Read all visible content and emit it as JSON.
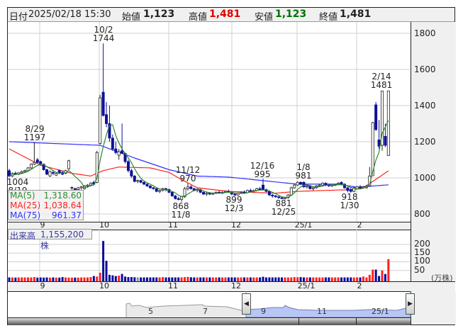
{
  "header": {
    "date_label": "日付",
    "datetime": "2025/02/18 15:30",
    "open_label": "始値",
    "open": "1,123",
    "high_label": "高値",
    "high": "1,481",
    "low_label": "安値",
    "low": "1,123",
    "close_label": "終値",
    "close": "1,481"
  },
  "colors": {
    "up_volume": "#ff2020",
    "down_volume": "#0a0a9a",
    "candle_down": "#10109a",
    "ma5": "#2e8b2e",
    "ma25": "#ff2020",
    "ma75": "#3030ff",
    "high_text": "#e00000",
    "low_text": "#007000"
  },
  "price_axis": {
    "ticks": [
      "1800",
      "1600",
      "1400",
      "1200",
      "1000",
      "800"
    ],
    "values": [
      1800,
      1600,
      1400,
      1200,
      1000,
      800
    ]
  },
  "volume_axis": {
    "ticks": [
      "200",
      "150",
      "100",
      "50"
    ],
    "values": [
      200,
      150,
      100,
      50
    ],
    "unit": "(万株)"
  },
  "month_labels": [
    "9",
    "10",
    "11",
    "12",
    "25/1",
    "2"
  ],
  "annotations": [
    {
      "date": "10/2",
      "price": "1744"
    },
    {
      "date": "8/29",
      "price": "1197"
    },
    {
      "price": "1004",
      "date": "8/19"
    },
    {
      "date": "11/12",
      "price": "970"
    },
    {
      "price": "868",
      "date": "11/8"
    },
    {
      "price": "899",
      "date": "12/3"
    },
    {
      "date": "12/16",
      "price": "995"
    },
    {
      "price": "881",
      "date": "12/25"
    },
    {
      "date": "1/8",
      "price": "981"
    },
    {
      "price": "918",
      "date": "1/30"
    },
    {
      "date": "2/14",
      "price": "1481"
    }
  ],
  "ma_legend": [
    {
      "label": "MA(5)",
      "value": "1,318.60"
    },
    {
      "label": "MA(25)",
      "value": "1,038.64"
    },
    {
      "label": "MA(75)",
      "value": "961.37"
    }
  ],
  "volume_legend": {
    "label": "出来高",
    "value": "1,155,200株"
  },
  "navigator": {
    "labels": [
      "5",
      "7",
      "9",
      "11",
      "25/1"
    ]
  },
  "chart_data": {
    "type": "candlestick",
    "ylim": [
      800,
      1800
    ],
    "ohlc": [
      [
        1040,
        1050,
        1004,
        1010
      ],
      [
        1010,
        1030,
        1005,
        1025
      ],
      [
        1025,
        1035,
        1015,
        1020
      ],
      [
        1020,
        1030,
        1015,
        1028
      ],
      [
        1028,
        1040,
        1022,
        1035
      ],
      [
        1035,
        1045,
        1028,
        1040
      ],
      [
        1040,
        1060,
        1035,
        1055
      ],
      [
        1055,
        1080,
        1050,
        1075
      ],
      [
        1075,
        1197,
        1070,
        1085
      ],
      [
        1100,
        1110,
        1080,
        1085
      ],
      [
        1090,
        1095,
        1070,
        1075
      ],
      [
        1075,
        1080,
        1040,
        1045
      ],
      [
        1045,
        1050,
        1015,
        1020
      ],
      [
        1010,
        1040,
        1005,
        1035
      ],
      [
        1030,
        1040,
        1015,
        1025
      ],
      [
        1015,
        1030,
        1010,
        1025
      ],
      [
        1040,
        1045,
        1020,
        1025
      ],
      [
        1030,
        1040,
        1015,
        1020
      ],
      [
        1025,
        1045,
        1020,
        1040
      ],
      [
        1050,
        1100,
        1045,
        1095
      ],
      [
        945,
        952,
        925,
        947
      ],
      [
        940,
        945,
        925,
        935
      ],
      [
        935,
        950,
        930,
        945
      ],
      [
        945,
        955,
        935,
        950
      ],
      [
        940,
        960,
        935,
        955
      ],
      [
        955,
        965,
        945,
        960
      ],
      [
        960,
        975,
        955,
        970
      ],
      [
        975,
        985,
        960,
        965
      ],
      [
        975,
        1150,
        970,
        1140
      ],
      [
        1190,
        1460,
        1185,
        1443
      ],
      [
        1474,
        1744,
        1340,
        1345
      ],
      [
        1350,
        1420,
        1280,
        1300
      ],
      [
        1300,
        1400,
        1200,
        1220
      ],
      [
        1220,
        1240,
        1150,
        1160
      ],
      [
        1160,
        1200,
        1130,
        1140
      ],
      [
        1125,
        1160,
        1100,
        1145
      ],
      [
        1150,
        1300,
        1140,
        1135
      ],
      [
        1135,
        1140,
        1080,
        1090
      ],
      [
        1090,
        1100,
        1030,
        1040
      ],
      [
        1040,
        1050,
        1000,
        1010
      ],
      [
        1010,
        1015,
        975,
        980
      ],
      [
        985,
        990,
        970,
        985
      ],
      [
        985,
        990,
        970,
        975
      ],
      [
        975,
        980,
        960,
        965
      ],
      [
        965,
        970,
        950,
        955
      ],
      [
        955,
        960,
        940,
        945
      ],
      [
        945,
        950,
        935,
        940
      ],
      [
        940,
        945,
        920,
        925
      ],
      [
        925,
        935,
        915,
        930
      ],
      [
        930,
        945,
        925,
        940
      ],
      [
        940,
        945,
        925,
        935
      ],
      [
        935,
        940,
        915,
        920
      ],
      [
        920,
        925,
        895,
        900
      ],
      [
        900,
        905,
        880,
        885
      ],
      [
        885,
        895,
        875,
        880
      ],
      [
        880,
        900,
        868,
        895
      ],
      [
        895,
        950,
        890,
        940
      ],
      [
        940,
        970,
        930,
        950
      ],
      [
        950,
        960,
        935,
        940
      ],
      [
        940,
        945,
        925,
        930
      ],
      [
        930,
        940,
        920,
        935
      ],
      [
        935,
        940,
        915,
        920
      ],
      [
        920,
        925,
        905,
        910
      ],
      [
        910,
        920,
        900,
        915
      ],
      [
        915,
        920,
        905,
        910
      ],
      [
        910,
        920,
        905,
        915
      ],
      [
        915,
        925,
        910,
        920
      ],
      [
        920,
        930,
        912,
        915
      ],
      [
        915,
        925,
        910,
        920
      ],
      [
        920,
        930,
        915,
        925
      ],
      [
        925,
        935,
        918,
        920
      ],
      [
        920,
        925,
        905,
        910
      ],
      [
        910,
        915,
        899,
        905
      ],
      [
        905,
        920,
        900,
        915
      ],
      [
        915,
        925,
        910,
        920
      ],
      [
        920,
        930,
        912,
        918
      ],
      [
        918,
        935,
        915,
        930
      ],
      [
        930,
        940,
        920,
        925
      ],
      [
        925,
        935,
        920,
        930
      ],
      [
        930,
        945,
        925,
        940
      ],
      [
        940,
        950,
        930,
        935
      ],
      [
        960,
        995,
        930,
        935
      ],
      [
        935,
        940,
        920,
        925
      ],
      [
        925,
        930,
        900,
        905
      ],
      [
        905,
        910,
        890,
        900
      ],
      [
        900,
        905,
        890,
        895
      ],
      [
        895,
        900,
        885,
        890
      ],
      [
        890,
        895,
        882,
        885
      ],
      [
        885,
        895,
        881,
        890
      ],
      [
        890,
        910,
        885,
        905
      ],
      [
        905,
        950,
        900,
        945
      ],
      [
        945,
        965,
        940,
        960
      ],
      [
        960,
        981,
        955,
        975
      ],
      [
        975,
        980,
        960,
        965
      ],
      [
        975,
        981,
        945,
        950
      ],
      [
        950,
        960,
        940,
        955
      ],
      [
        955,
        960,
        935,
        940
      ],
      [
        940,
        950,
        930,
        945
      ],
      [
        945,
        960,
        940,
        955
      ],
      [
        955,
        965,
        950,
        960
      ],
      [
        960,
        975,
        955,
        970
      ],
      [
        970,
        975,
        955,
        960
      ],
      [
        960,
        965,
        950,
        955
      ],
      [
        955,
        965,
        950,
        960
      ],
      [
        960,
        965,
        955,
        962
      ],
      [
        965,
        975,
        960,
        970
      ],
      [
        975,
        980,
        960,
        965
      ],
      [
        965,
        970,
        940,
        945
      ],
      [
        945,
        950,
        920,
        930
      ],
      [
        935,
        945,
        918,
        925
      ],
      [
        925,
        950,
        920,
        945
      ],
      [
        940,
        955,
        935,
        950
      ],
      [
        950,
        960,
        940,
        945
      ],
      [
        945,
        955,
        940,
        950
      ],
      [
        945,
        960,
        940,
        955
      ],
      [
        955,
        1060,
        950,
        1010
      ],
      [
        1012,
        1310,
        1010,
        1306
      ],
      [
        1404,
        1420,
        1260,
        1267
      ],
      [
        1210,
        1320,
        1160,
        1175
      ],
      [
        1180,
        1481,
        1150,
        1481
      ],
      [
        1230,
        1300,
        1170,
        1180
      ],
      [
        1123,
        1481,
        1123,
        1481
      ]
    ],
    "volume": [
      10,
      10,
      9,
      10,
      10,
      10,
      10,
      10,
      12,
      9,
      10,
      9,
      10,
      9,
      10,
      9,
      9,
      12,
      10,
      9,
      9,
      9,
      9,
      10,
      10,
      10,
      12,
      18,
      15,
      37,
      220,
      106,
      25,
      22,
      18,
      20,
      30,
      15,
      12,
      12,
      11,
      10,
      10,
      10,
      10,
      10,
      10,
      10,
      10,
      12,
      10,
      10,
      10,
      10,
      10,
      10,
      12,
      13,
      11,
      10,
      10,
      10,
      10,
      10,
      10,
      10,
      10,
      10,
      10,
      10,
      10,
      10,
      10,
      10,
      10,
      10,
      10,
      10,
      10,
      10,
      10,
      14,
      10,
      10,
      10,
      10,
      10,
      10,
      10,
      10,
      10,
      12,
      11,
      12,
      10,
      10,
      10,
      10,
      10,
      10,
      10,
      10,
      10,
      10,
      10,
      10,
      10,
      10,
      10,
      10,
      10,
      10,
      10,
      15,
      10,
      25,
      55,
      55,
      18,
      50,
      30,
      115.5
    ],
    "ma25_points": [
      [
        0,
        1160
      ],
      [
        10,
        1070
      ],
      [
        20,
        1025
      ],
      [
        26,
        1010
      ],
      [
        30,
        1040
      ],
      [
        35,
        1060
      ],
      [
        45,
        1055
      ],
      [
        51,
        1030
      ],
      [
        55,
        990
      ],
      [
        60,
        945
      ],
      [
        70,
        925
      ],
      [
        85,
        915
      ],
      [
        92,
        925
      ],
      [
        100,
        930
      ],
      [
        110,
        935
      ],
      [
        113,
        945
      ],
      [
        121,
        1038.64
      ]
    ],
    "ma75_points": [
      [
        0,
        1200
      ],
      [
        29,
        1180
      ],
      [
        40,
        1110
      ],
      [
        51,
        1045
      ],
      [
        60,
        1010
      ],
      [
        70,
        1004
      ],
      [
        92,
        965
      ],
      [
        105,
        965
      ],
      [
        111,
        948
      ],
      [
        121,
        961.37
      ]
    ]
  }
}
